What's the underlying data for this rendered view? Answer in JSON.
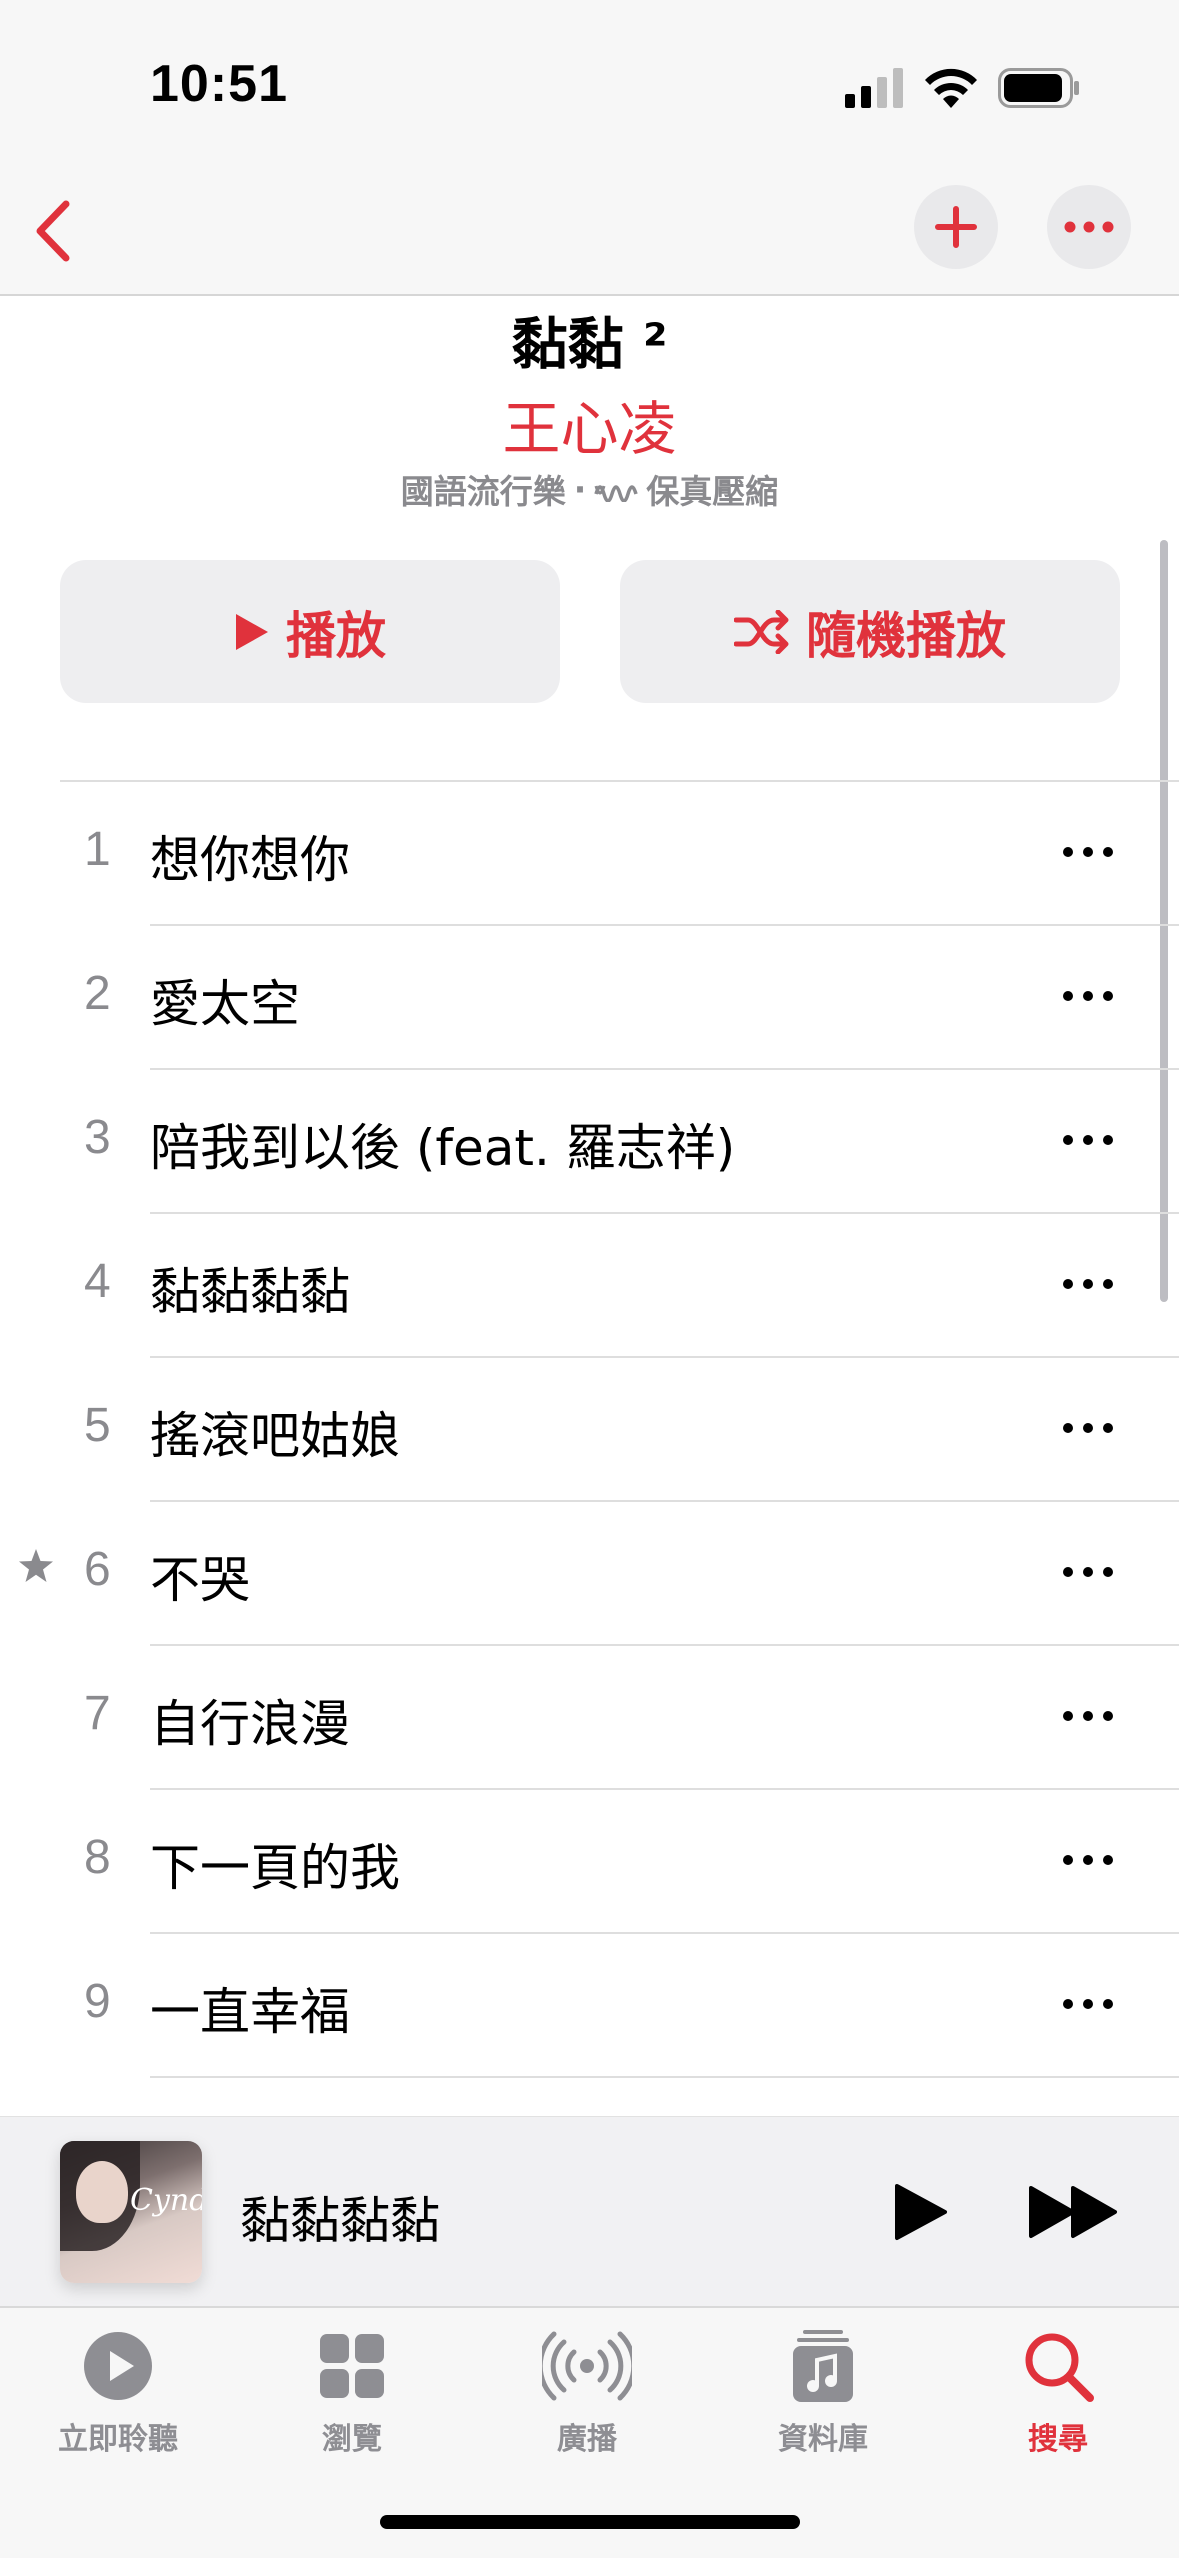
{
  "status": {
    "time": "10:51"
  },
  "album": {
    "title": "黏黏 ²",
    "artist": "王心凌",
    "genre": "國語流行樂",
    "separator": "·",
    "quality": "保真壓縮"
  },
  "actions": {
    "play": "播放",
    "shuffle": "隨機播放"
  },
  "tracks": [
    {
      "num": "1",
      "title": "想你想你",
      "starred": false
    },
    {
      "num": "2",
      "title": "愛太空",
      "starred": false
    },
    {
      "num": "3",
      "title": "陪我到以後 (feat. 羅志祥)",
      "starred": false
    },
    {
      "num": "4",
      "title": "黏黏黏黏",
      "starred": false
    },
    {
      "num": "5",
      "title": "搖滾吧姑娘",
      "starred": false
    },
    {
      "num": "6",
      "title": "不哭",
      "starred": true
    },
    {
      "num": "7",
      "title": "自行浪漫",
      "starred": false
    },
    {
      "num": "8",
      "title": "下一頁的我",
      "starred": false
    },
    {
      "num": "9",
      "title": "一直幸福",
      "starred": false
    }
  ],
  "now_playing": {
    "title": "黏黏黏黏",
    "art_text": "Cyndi"
  },
  "tabs": [
    {
      "label": "立即聆聽",
      "icon": "play-circle-icon",
      "active": false
    },
    {
      "label": "瀏覽",
      "icon": "grid-icon",
      "active": false
    },
    {
      "label": "廣播",
      "icon": "radio-waves-icon",
      "active": false
    },
    {
      "label": "資料庫",
      "icon": "music-library-icon",
      "active": false
    },
    {
      "label": "搜尋",
      "icon": "search-icon",
      "active": true
    }
  ],
  "colors": {
    "accent": "#e0323c",
    "secondary_text": "#8a8a8e",
    "button_bg": "#eeeef0"
  }
}
